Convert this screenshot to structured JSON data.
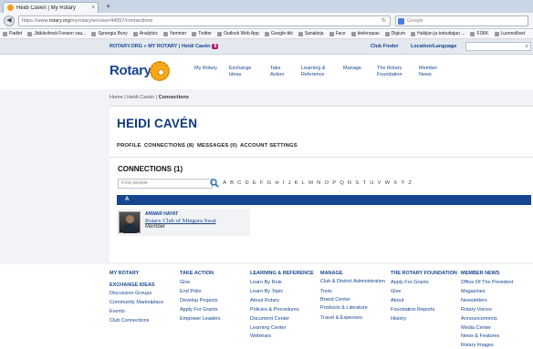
{
  "browser": {
    "tab_title": "Heidi Cavén | My Rotary",
    "tab_close": "×",
    "new_tab": "+",
    "url_prefix": "https://www.",
    "url_domain": "rotary.org",
    "url_rest": "/myrotary/en/user/44557/connections",
    "search_placeholder": "Google",
    "bookmarks": [
      "Padlet",
      "Jätkävihreä Fonsen vau...",
      "Synergia Boxy",
      "Analytics",
      "Yammer",
      "Twitter",
      "Outlook Web App",
      "Google-tiiit",
      "Sanakirja",
      "Face",
      "kielenopas",
      "Digium",
      "Hakijan ja toteuttajan ...",
      "FSKK",
      "Luonnolliset"
    ]
  },
  "utility": {
    "breadcrumb_site": "ROTARY.ORG",
    "breadcrumb_sep": " » ",
    "breadcrumb_my": "MY ROTARY",
    "breadcrumb_bar": " | ",
    "breadcrumb_user": "Heidi Cavén",
    "notification_count": "8",
    "club_finder": "Club Finder",
    "location": "Location/Language",
    "search_icon": "⌕"
  },
  "logo": {
    "wordmark": "Rotary"
  },
  "main_nav": [
    "My Rotary",
    "Exchange Ideas",
    "Take Action",
    "Learning & Reference",
    "Manage",
    "The Rotary Foundation",
    "Member News"
  ],
  "path": {
    "home": "Home",
    "sep1": " | ",
    "user": "Heidi Cavén",
    "sep2": " | ",
    "current": "Connections"
  },
  "profile": {
    "name": "HEIDI CAVÉN",
    "tabs": [
      "PROFILE",
      "CONNECTIONS (8)",
      "MESSAGES (0)",
      "ACCOUNT SETTINGS"
    ]
  },
  "connections": {
    "title": "CONNECTIONS (1)",
    "search_placeholder": "Find people",
    "letters": [
      "A",
      "B",
      "C",
      "D",
      "E",
      "F",
      "G",
      "H",
      "I",
      "J",
      "K",
      "L",
      "M",
      "N",
      "O",
      "P",
      "Q",
      "R",
      "S",
      "T",
      "U",
      "V",
      "W",
      "X",
      "Y",
      "Z"
    ],
    "group_letter": "A",
    "people": [
      {
        "name": "ANWAR HAYAT",
        "club": "Rotary Club of Mingora Swat",
        "role": "Member"
      }
    ]
  },
  "footer": {
    "columns": [
      {
        "heading": "MY ROTARY",
        "items": [],
        "subheading": "EXCHANGE IDEAS",
        "subitems": [
          "Discussion Groups",
          "Community Marketplace",
          "Events",
          "Club Connections"
        ]
      },
      {
        "heading": "TAKE ACTION",
        "items": [
          "Give",
          "End Polio",
          "Develop Projects",
          "Apply For Grants",
          "Empower Leaders"
        ]
      },
      {
        "heading": "LEARNING & REFERENCE",
        "items": [
          "Learn By Role",
          "Learn By Topic",
          "About Rotary",
          "Policies & Procedures",
          "Document Center",
          "Learning Center",
          "Webinars"
        ]
      },
      {
        "heading": "MANAGE",
        "items": [
          "Club & District Administration",
          "Tools",
          "Brand Center",
          "Products & Literature",
          "Travel & Expenses"
        ]
      },
      {
        "heading": "THE ROTARY FOUNDATION",
        "items": [
          "Apply For Grants",
          "Give",
          "About",
          "Foundation Reports",
          "History"
        ]
      },
      {
        "heading": "MEMBER NEWS",
        "items": [
          "Office Of The President",
          "Magazines",
          "Newsletters",
          "Rotary Voices",
          "Announcements",
          "Media Center",
          "News & Features",
          "Rotary Images"
        ]
      }
    ]
  }
}
